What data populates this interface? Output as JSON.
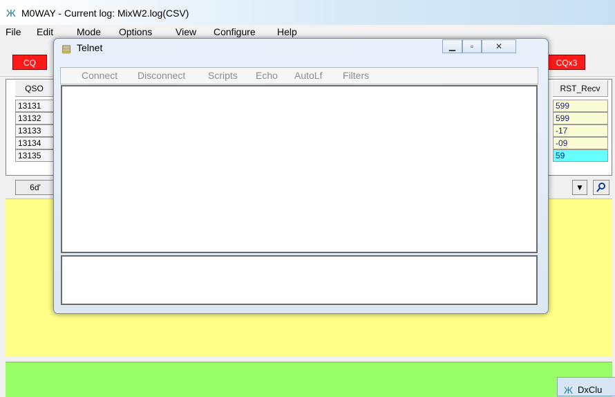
{
  "window": {
    "title": "M0WAY - Current log: MixW2.log(CSV)"
  },
  "menu": [
    "File",
    "Edit",
    "Mode",
    "Options",
    "View",
    "Configure",
    "Help"
  ],
  "toolbar": {
    "left_button": "CQ",
    "right_button": "CQx3"
  },
  "log_grid": {
    "qso_header": "QSO",
    "rst_header": "RST_Recv",
    "qso_numbers": [
      "13131",
      "13132",
      "13133",
      "13134",
      "13135"
    ],
    "rst_values": [
      "599",
      "599",
      "-17",
      "-09",
      "59"
    ]
  },
  "filter_row": {
    "view_button": "6d'"
  },
  "telnet": {
    "title": "Telnet",
    "menu": [
      "Connect",
      "Disconnect",
      "Scripts",
      "Echo",
      "AutoLf",
      "Filters"
    ],
    "output_text": "",
    "input_text": ""
  },
  "dxcluster": {
    "title": "DxClu"
  },
  "colors": {
    "cq_red": "#ff1a1a",
    "log_panel": "#ffff88",
    "status_panel": "#99ff66",
    "selected_cell": "#66ffff"
  }
}
